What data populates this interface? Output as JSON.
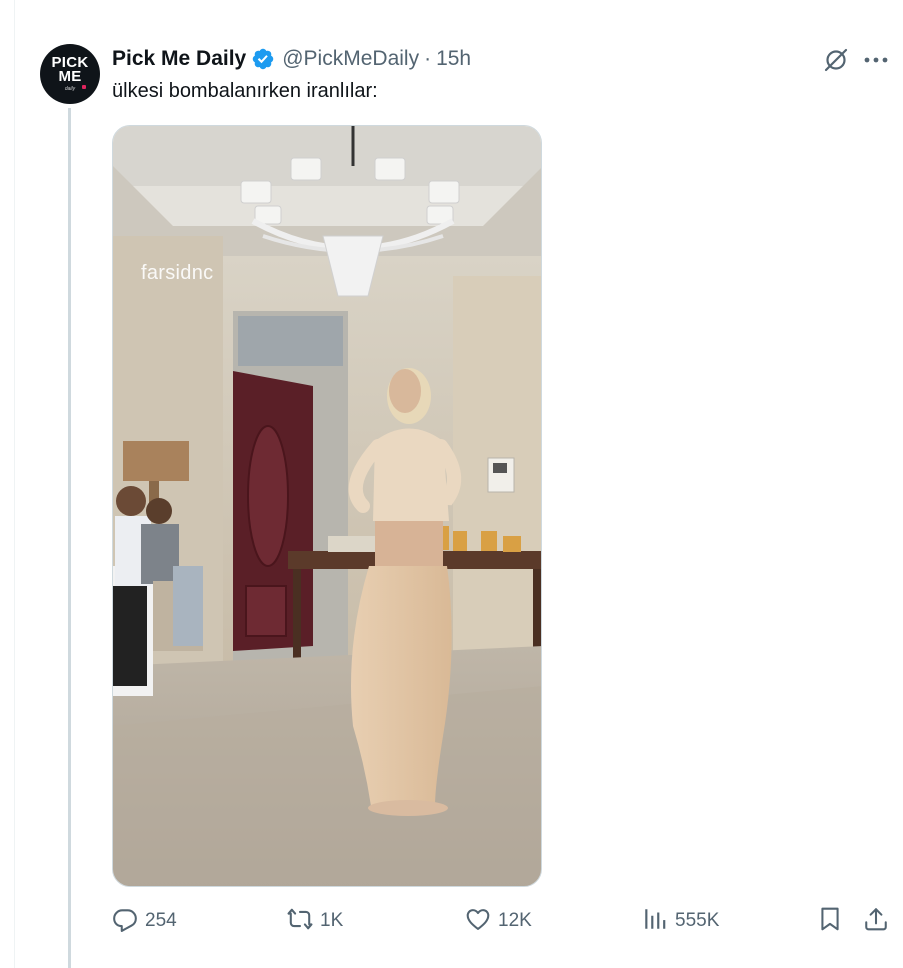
{
  "author": {
    "name": "Pick Me Daily",
    "handle": "@PickMeDaily",
    "time": "15h",
    "separator": "·",
    "avatar_text_line1": "PICK",
    "avatar_text_line2": "ME",
    "avatar_text_line3": "daily",
    "verified_color": "#1d9bf0"
  },
  "tweet": {
    "text": "ülkesi bombalanırken iranlılar:"
  },
  "media": {
    "watermark": "farsidnc",
    "type": "video"
  },
  "actions": {
    "replies": "254",
    "reposts": "1K",
    "likes": "12K",
    "views": "555K"
  },
  "icons": {
    "grok": "grok-icon",
    "more": "more-icon",
    "reply": "reply-icon",
    "repost": "repost-icon",
    "like": "like-icon",
    "views": "views-icon",
    "bookmark": "bookmark-icon",
    "share": "share-icon"
  },
  "colors": {
    "text": "#0f1419",
    "secondary": "#536471",
    "thread_line": "#cfd9de"
  }
}
